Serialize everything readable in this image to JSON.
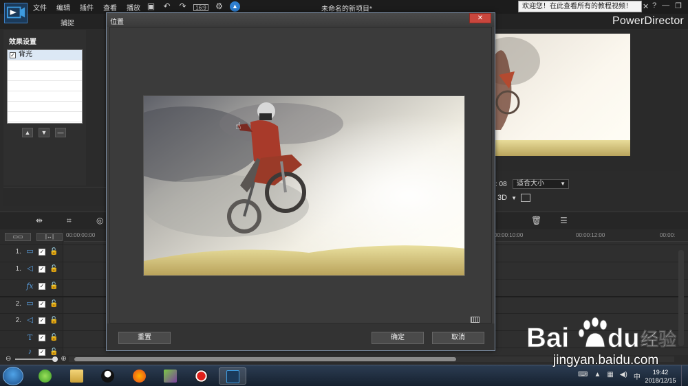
{
  "menu": {
    "file": "文件",
    "edit": "编辑",
    "plugins": "插件",
    "view": "查看",
    "play": "播放"
  },
  "window_title": "未命名的新项目*",
  "welcome_text": "欢迎您！在此查看所有的教程视频！",
  "welcome_close": "✕",
  "window_controls": {
    "help": "?",
    "minimize": "—",
    "restore": "❐",
    "close": "✕"
  },
  "mode_tabs": {
    "capture": "捕捉"
  },
  "brand": "PowerDirector",
  "effect_panel": {
    "title": "效果设置",
    "items": [
      {
        "label": "背光",
        "checked": true
      }
    ]
  },
  "preview": {
    "time": ": 08",
    "fit_option": "适合大小",
    "mode_3d": "3D"
  },
  "timeline": {
    "ruler_labels": [
      "00:00:00:00",
      "00:00:10:00",
      "00:00:12:00",
      "00:00:"
    ],
    "tracks": [
      {
        "number": "1.",
        "type": "video"
      },
      {
        "number": "1.",
        "type": "audio"
      },
      {
        "number": "",
        "type": "fx",
        "icon_text": "fx"
      },
      {
        "number": "2.",
        "type": "video"
      },
      {
        "number": "2.",
        "type": "audio"
      },
      {
        "number": "",
        "type": "title",
        "icon_text": "T"
      },
      {
        "number": "",
        "type": "voice"
      }
    ]
  },
  "dialog": {
    "title": "位置",
    "close": "✕",
    "reset_label": "重置",
    "ok_label": "确定",
    "cancel_label": "取消"
  },
  "taskbar": {
    "clock_time": "19:42",
    "clock_date": "2018/12/15"
  },
  "watermark": {
    "url": "jingyan.baidu.com"
  }
}
